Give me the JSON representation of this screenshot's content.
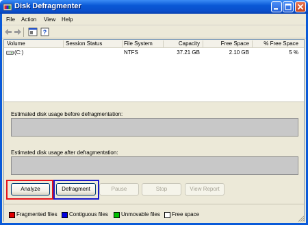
{
  "window": {
    "title": "Disk Defragmenter"
  },
  "menu": [
    "File",
    "Action",
    "View",
    "Help"
  ],
  "toolbar": [
    "back-icon",
    "forward-icon",
    "properties-icon",
    "help-icon"
  ],
  "columns": [
    "Volume",
    "Session Status",
    "File System",
    "Capacity",
    "Free Space",
    "% Free Space"
  ],
  "volumes": [
    {
      "volume": "(C:)",
      "status": "",
      "file_system": "NTFS",
      "capacity": "37.21 GB",
      "free_space": "2.10 GB",
      "percent_free": "5 %"
    }
  ],
  "estimates": {
    "before_label": "Estimated disk usage before defragmentation:",
    "after_label": "Estimated disk usage after defragmentation:"
  },
  "buttons": {
    "analyze": "Analyze",
    "defragment": "Defragment",
    "pause": "Pause",
    "stop": "Stop",
    "view_report": "View Report"
  },
  "legend": [
    {
      "label": "Fragmented files",
      "color": "#e00000"
    },
    {
      "label": "Contiguous files",
      "color": "#0000e0"
    },
    {
      "label": "Unmovable files",
      "color": "#00c000"
    },
    {
      "label": "Free space",
      "color": "#ffffff"
    }
  ]
}
